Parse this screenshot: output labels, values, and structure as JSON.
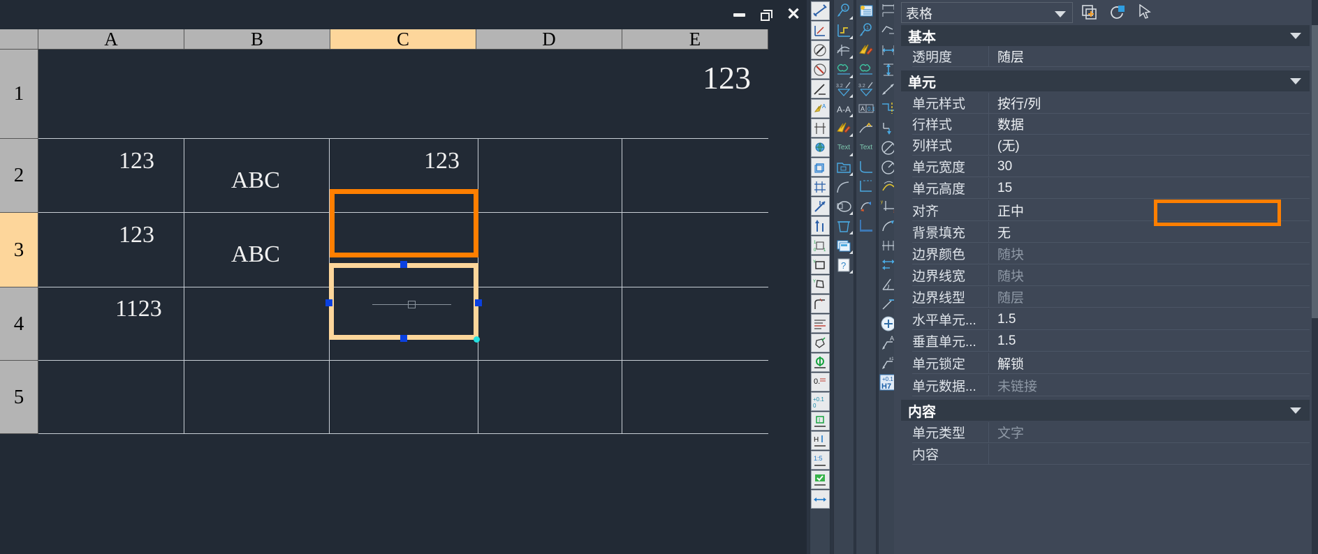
{
  "window": {
    "minimize_label": "minimize",
    "maximize_label": "restore",
    "close_label": "close"
  },
  "table": {
    "columns": [
      "",
      "A",
      "B",
      "C",
      "D",
      "E"
    ],
    "selected_column": "C",
    "rows": [
      "1",
      "2",
      "3",
      "4",
      "5"
    ],
    "selected_row": "3",
    "cells": [
      {
        "row": "1",
        "col": "E",
        "value": "123"
      },
      {
        "row": "2",
        "col": "A",
        "value": "123"
      },
      {
        "row": "2",
        "col": "B",
        "value": "ABC"
      },
      {
        "row": "2",
        "col": "C",
        "value": "123"
      },
      {
        "row": "3",
        "col": "A",
        "value": "123"
      },
      {
        "row": "3",
        "col": "B",
        "value": "ABC"
      },
      {
        "row": "4",
        "col": "A",
        "value": "1123"
      }
    ],
    "active_cell": "C3",
    "annotated_cell": "C2",
    "colors": {
      "selection_highlight": "#fdd69b",
      "annotation": "#ff7f00",
      "grip": "#0b41e0",
      "header": "#b4b4b4",
      "canvas": "#222a35"
    }
  },
  "properties_panel": {
    "object_type": "表格",
    "header_icons": [
      "quick-select-icon",
      "pick-add-icon",
      "cursor-icon"
    ],
    "groups": [
      {
        "title": "基本",
        "rows": [
          {
            "name": "透明度",
            "value": "随层",
            "dim": false
          }
        ]
      },
      {
        "title": "单元",
        "rows": [
          {
            "name": "单元样式",
            "value": "按行/列",
            "dim": false
          },
          {
            "name": "行样式",
            "value": "数据",
            "dim": false
          },
          {
            "name": "列样式",
            "value": "(无)",
            "dim": false
          },
          {
            "name": "单元宽度",
            "value": "30",
            "dim": false
          },
          {
            "name": "单元高度",
            "value": "15",
            "dim": false
          },
          {
            "name": "对齐",
            "value": "正中",
            "dim": false
          },
          {
            "name": "背景填充",
            "value": "无",
            "dim": false
          },
          {
            "name": "边界颜色",
            "value": "随块",
            "dim": true
          },
          {
            "name": "边界线宽",
            "value": "随块",
            "dim": true
          },
          {
            "name": "边界线型",
            "value": "随层",
            "dim": true
          },
          {
            "name": "水平单元...",
            "value": "1.5",
            "dim": false
          },
          {
            "name": "垂直单元...",
            "value": "1.5",
            "dim": false
          },
          {
            "name": "单元锁定",
            "value": "解锁",
            "dim": false
          },
          {
            "name": "单元数据...",
            "value": "未链接",
            "dim": true
          }
        ]
      },
      {
        "title": "内容",
        "rows": [
          {
            "name": "单元类型",
            "value": "文字",
            "dim": true
          },
          {
            "name": "内容",
            "value": "",
            "dim": false
          }
        ]
      }
    ],
    "highlighted_row": "对齐"
  },
  "toolbars": {
    "columns": [
      {
        "name": "dimension-tools-column-1",
        "icons": [
          "dim-linear-diagonal-icon",
          "dim-ordinate-xy-icon",
          "dim-compass-icon",
          "dim-compass-arrow-icon",
          "dim-leader-slash-icon",
          "dim-annotation-bolt-icon",
          "dim-baseline-icon",
          "dim-globe-view-icon",
          "dim-3d-box-icon",
          "dim-grid-cross-icon",
          "dim-axis-move-icon",
          "dim-axis-updown-icon",
          "dim-tolerance-101-icon",
          "dim-coord-frame-icon",
          "dim-shape-coord-icon",
          "dim-corner-radius-icon",
          "dim-table-lines-icon",
          "dim-polygon-edit-icon",
          "dim-green-phi-icon",
          "dim-zero-value-icon",
          "dim-plus-tolerance-icon",
          "dim-boxed-i-icon",
          "dim-h-height-icon",
          "dim-scale-15-icon",
          "dim-check-green-icon",
          "dim-double-arrow-icon"
        ]
      },
      {
        "name": "annotation-tools-column-2",
        "icons": [
          "circle-number-1-icon",
          "axis-yellow-curve-icon",
          "curve-cross-icon",
          "revision-cloud-icon",
          "slope-32-icon",
          "text-a-a-icon",
          "lightning-pencil-icon",
          "text-label-icon",
          "folder-block-icon",
          "arc-icon",
          "ellipse-view-icon",
          "trash-bin-icon",
          "window-stack-icon",
          "help-question-icon"
        ]
      },
      {
        "name": "annotation-tools-column-3",
        "icons": [
          "doc-sun-icon",
          "circle-number-1-icon",
          "lightning-pencil-icon",
          "revision-cloud-icon",
          "slope-32-icon",
          "field-a01-icon",
          "leader-flag-icon",
          "text-label-icon",
          "curve-corner-icon",
          "corner-dashed-icon",
          "arc-arrow-icon",
          "corner-hatch-icon"
        ]
      },
      {
        "name": "dimension-tools-column-4",
        "icons": [
          "dim-linear-icon",
          "dim-aligned-icon",
          "dim-horizontal-icon",
          "dim-vertical-icon",
          "dim-rotated-icon",
          "dim-jogged-icon",
          "dim-baseline-drop-icon",
          "dim-diameter-icon",
          "dim-radius-icon",
          "dim-arc-length-icon",
          "dim-ordinate-xy-icon",
          "dim-curve-icon",
          "dim-continue-icon",
          "dim-chain-icon",
          "dim-angular-icon",
          "dim-leader-icon",
          "dim-center-mark-icon",
          "dim-leader-text-icon",
          "dim-leader-tol-icon",
          "dim-tolerance-h7-icon"
        ]
      }
    ]
  }
}
